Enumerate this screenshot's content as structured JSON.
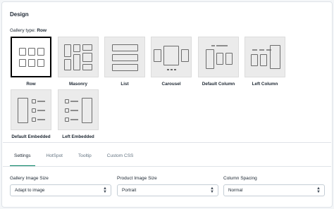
{
  "design": {
    "title": "Design",
    "gallery_type_label": "Gallery type:",
    "gallery_type_value": "Row"
  },
  "layouts": [
    {
      "label": "Row",
      "selected": true
    },
    {
      "label": "Masonry",
      "selected": false
    },
    {
      "label": "List",
      "selected": false
    },
    {
      "label": "Carousel",
      "selected": false
    },
    {
      "label": "Default Column",
      "selected": false
    },
    {
      "label": "Left Column",
      "selected": false
    },
    {
      "label": "Default Embedded",
      "selected": false
    },
    {
      "label": "Left Embedded",
      "selected": false
    }
  ],
  "tabs": [
    {
      "label": "Settings",
      "active": true
    },
    {
      "label": "HotSpot",
      "active": false
    },
    {
      "label": "Tooltip",
      "active": false
    },
    {
      "label": "Custom CSS",
      "active": false
    }
  ],
  "fields": [
    {
      "label": "Gallery Image Size",
      "value": "Adapt to image"
    },
    {
      "label": "Product Image Size",
      "value": "Portrait"
    },
    {
      "label": "Column Spacing",
      "value": "Normal"
    }
  ],
  "colors": {
    "accent": "#008060",
    "selected_border": "#000000"
  }
}
